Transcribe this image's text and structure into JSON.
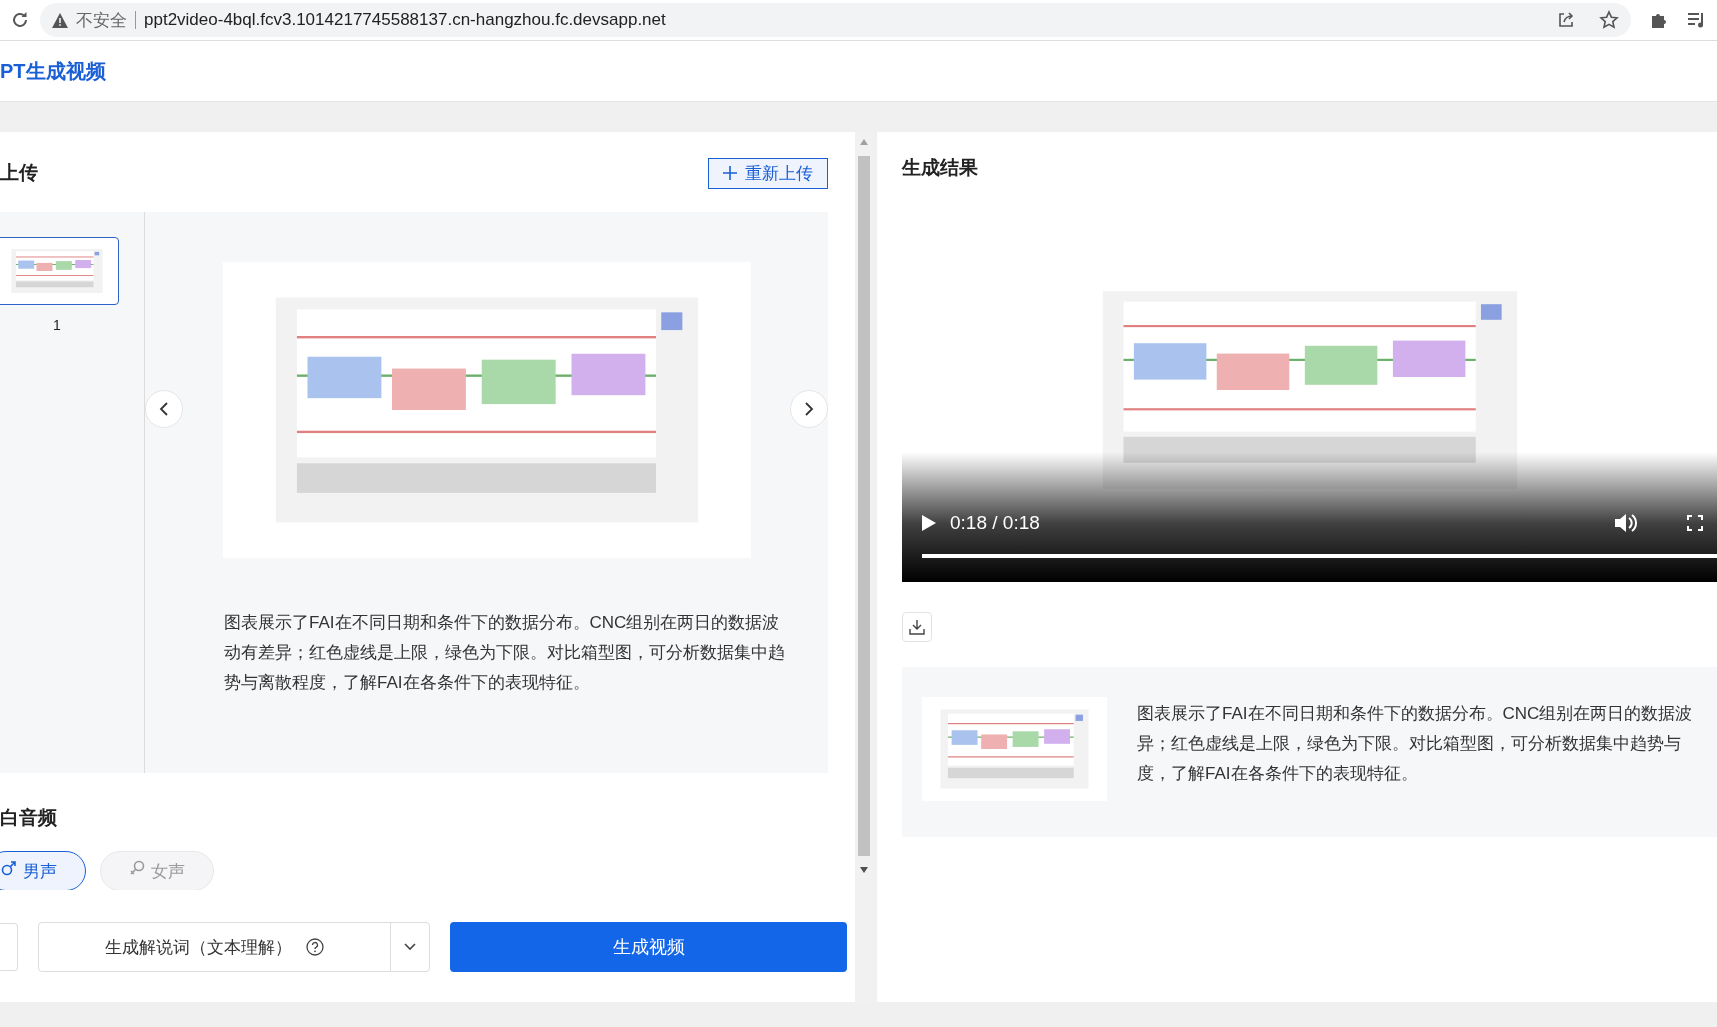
{
  "browser": {
    "security_label": "不安全",
    "url": "ppt2video-4bql.fcv3.1014217745588137.cn-hangzhou.fc.devsapp.net"
  },
  "app": {
    "title": "PT生成视频"
  },
  "upload_panel": {
    "title": "上传",
    "reupload_button": "重新上传",
    "slides": [
      {
        "number": "1",
        "selected": true
      }
    ],
    "description": "图表展示了FAI在不同日期和条件下的数据分布。CNC组别在两日的数据波动有差异；红色虚线是上限，绿色为下限。对比箱型图，可分析数据集中趋势与离散程度，了解FAI在各条件下的表现特征。"
  },
  "audio_section": {
    "title": "白音频",
    "voices": [
      {
        "label": "男声",
        "kind": "male",
        "selected": true
      },
      {
        "label": "女声",
        "kind": "female",
        "selected": false
      }
    ]
  },
  "actions": {
    "script_mode": "生成解说词（文本理解）",
    "generate_button": "生成视频"
  },
  "result_panel": {
    "title": "生成结果",
    "video": {
      "time": "0:18 / 0:18",
      "progress": {
        "level": 1
      }
    },
    "description_lines": [
      "图表展示了FAI在不同日期和条件下的数据分布。CNC组别在两日的数据波",
      "异；红色虚线是上限，绿色为下限。对比箱型图，可分析数据集中趋势与",
      "度，了解FAI在各条件下的表现特征。"
    ]
  }
}
